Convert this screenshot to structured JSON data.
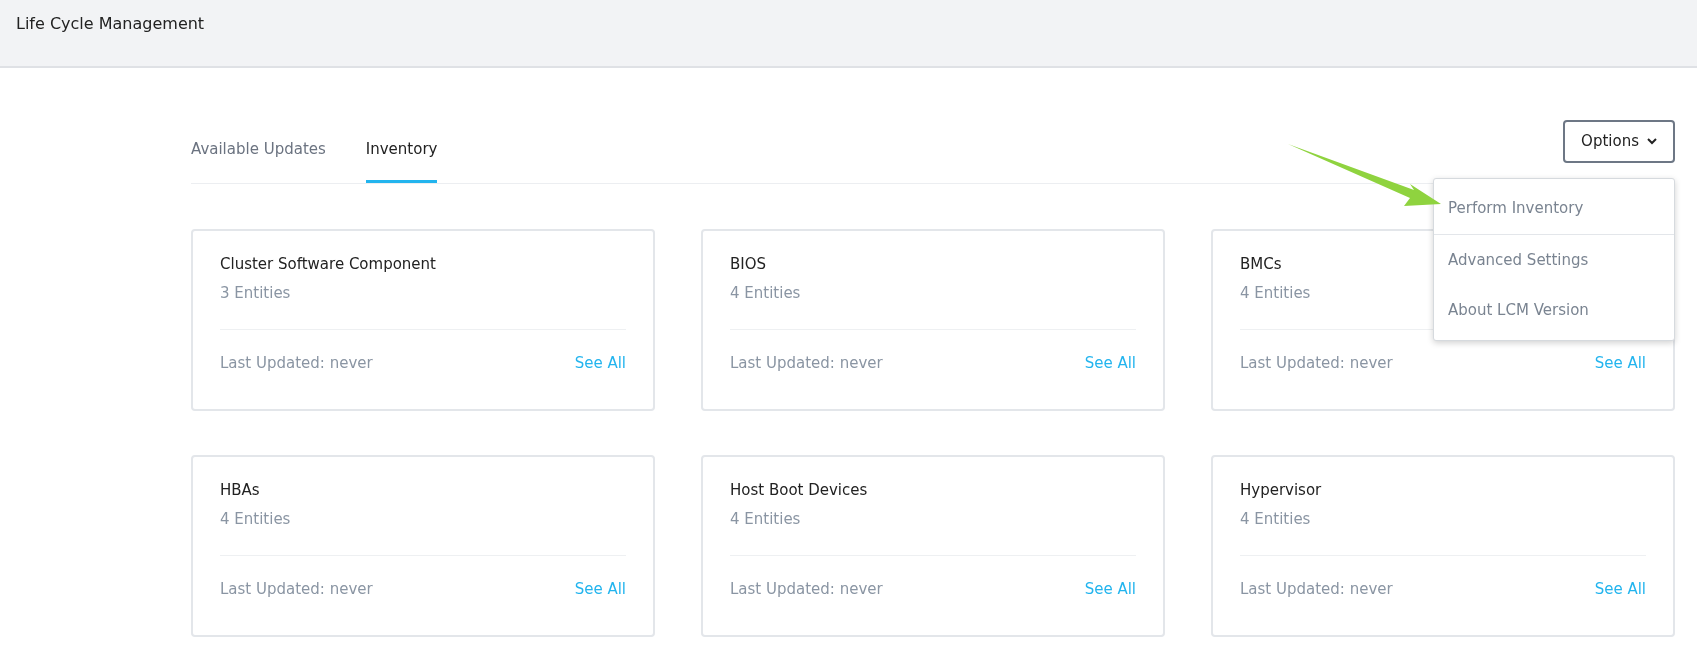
{
  "header": {
    "title": "Life Cycle Management"
  },
  "tabs": [
    {
      "label": "Available Updates",
      "selected": false
    },
    {
      "label": "Inventory",
      "selected": true
    }
  ],
  "options_button": {
    "label": "Options",
    "expanded": true
  },
  "options_menu": [
    {
      "label": "Perform Inventory",
      "divider_after": true
    },
    {
      "label": "Advanced Settings",
      "divider_after": false
    },
    {
      "label": "About LCM Version",
      "divider_after": false
    }
  ],
  "cards": [
    {
      "title": "Cluster Software Component",
      "count": "3 Entities",
      "last_updated": "Last Updated: never",
      "link": "See All"
    },
    {
      "title": "BIOS",
      "count": "4 Entities",
      "last_updated": "Last Updated: never",
      "link": "See All"
    },
    {
      "title": "BMCs",
      "count": "4 Entities",
      "last_updated": "Last Updated: never",
      "link": "See All"
    },
    {
      "title": "HBAs",
      "count": "4 Entities",
      "last_updated": "Last Updated: never",
      "link": "See All"
    },
    {
      "title": "Host Boot Devices",
      "count": "4 Entities",
      "last_updated": "Last Updated: never",
      "link": "See All"
    },
    {
      "title": "Hypervisor",
      "count": "4 Entities",
      "last_updated": "Last Updated: never",
      "link": "See All"
    }
  ]
}
